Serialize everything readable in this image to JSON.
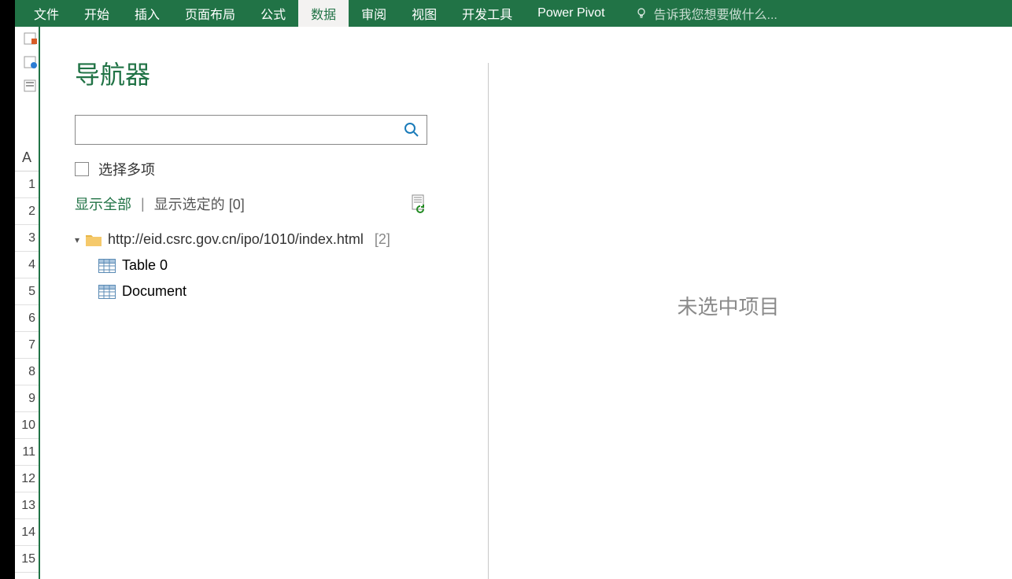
{
  "ribbon": {
    "tabs": [
      "文件",
      "开始",
      "插入",
      "页面布局",
      "公式",
      "数据",
      "审阅",
      "视图",
      "开发工具",
      "Power Pivot"
    ],
    "active_index": 5,
    "tell_me_placeholder": "告诉我您想要做什么..."
  },
  "column_header": "A",
  "row_numbers": [
    "1",
    "2",
    "3",
    "4",
    "5",
    "6",
    "7",
    "8",
    "9",
    "10",
    "11",
    "12",
    "13",
    "14",
    "15"
  ],
  "navigator": {
    "title": "导航器",
    "multi_select_label": "选择多项",
    "show_all_label": "显示全部",
    "show_selected_label": "显示选定的 [0]",
    "root": {
      "url": "http://eid.csrc.gov.cn/ipo/1010/index.html",
      "count": "[2]"
    },
    "items": [
      "Table 0",
      "Document"
    ],
    "no_selection": "未选中项目"
  }
}
